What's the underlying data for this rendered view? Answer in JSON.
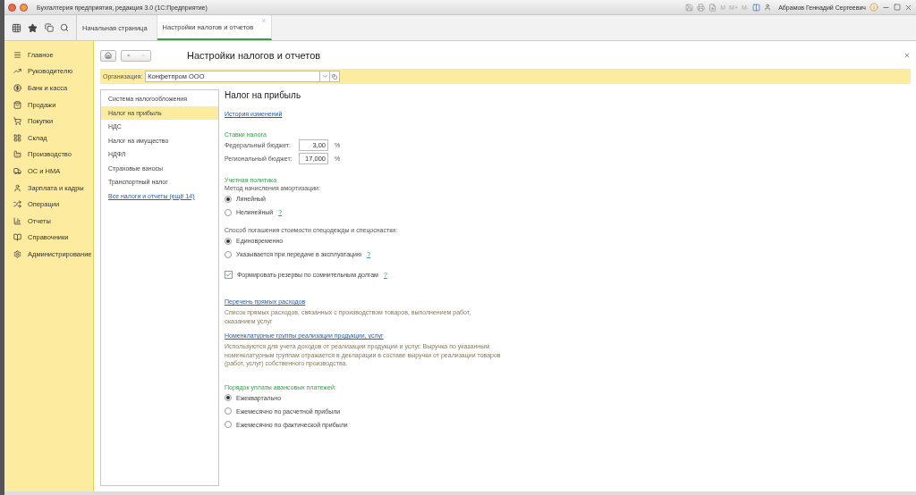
{
  "window": {
    "title": "Бухгалтерия предприятия, редакция 3.0  (1С:Предприятие)",
    "memory_buttons": [
      "M",
      "M+",
      "M-"
    ],
    "user": "Абрамов Геннадий Сергеевич"
  },
  "tabs": [
    {
      "label": "Начальная страница",
      "selected": false,
      "closable": false
    },
    {
      "label": "Настройки налогов и отчетов",
      "selected": true,
      "closable": true
    }
  ],
  "sidebar": {
    "items": [
      {
        "label": "Главное"
      },
      {
        "label": "Руководителю"
      },
      {
        "label": "Банк и касса"
      },
      {
        "label": "Продажи"
      },
      {
        "label": "Покупки"
      },
      {
        "label": "Склад"
      },
      {
        "label": "Производство"
      },
      {
        "label": "ОС и НМА"
      },
      {
        "label": "Зарплата и кадры"
      },
      {
        "label": "Операции"
      },
      {
        "label": "Отчеты"
      },
      {
        "label": "Справочники"
      },
      {
        "label": "Администрирование"
      }
    ]
  },
  "page": {
    "title": "Настройки налогов и отчетов",
    "organization": {
      "label": "Организация:",
      "value": "Конфетпром ООО"
    }
  },
  "sections": [
    {
      "label": "Система налогообложения",
      "selected": false,
      "kind": "item"
    },
    {
      "label": "Налог на прибыль",
      "selected": true,
      "kind": "item"
    },
    {
      "label": "НДС",
      "selected": false,
      "kind": "item"
    },
    {
      "label": "Налог на имущество",
      "selected": false,
      "kind": "item"
    },
    {
      "label": "НДФЛ",
      "selected": false,
      "kind": "item"
    },
    {
      "label": "Страховые взносы",
      "selected": false,
      "kind": "item"
    },
    {
      "label": "Транспортный налог",
      "selected": false,
      "kind": "item"
    },
    {
      "label": "Все налоги и отчеты (ещё 14)",
      "selected": false,
      "kind": "link"
    }
  ],
  "detail": {
    "title": "Налог на прибыль",
    "history_link": "История изменений",
    "blocks": [
      {
        "kind": "group",
        "text": "Ставки налога"
      },
      {
        "kind": "field",
        "label": "Федеральный бюджет:",
        "value": "3,00",
        "unit": "%"
      },
      {
        "kind": "field",
        "label": "Региональный бюджет:",
        "value": "17,000",
        "unit": "%"
      },
      {
        "kind": "gap"
      },
      {
        "kind": "group",
        "text": "Учетная политика"
      },
      {
        "kind": "label",
        "text": "Метод начисления амортизации:"
      },
      {
        "kind": "radio",
        "label": "Линейный",
        "selected": true
      },
      {
        "kind": "radio",
        "label": "Нелинейный",
        "selected": false,
        "help": "?"
      },
      {
        "kind": "gap"
      },
      {
        "kind": "label",
        "text": "Способ погашения стоимости спецодежды и спецоснастки:"
      },
      {
        "kind": "radio",
        "label": "Единовременно",
        "selected": true
      },
      {
        "kind": "radio",
        "label": "Указывается при передаче в эксплуатацию",
        "selected": false,
        "help": "?"
      },
      {
        "kind": "gap"
      },
      {
        "kind": "checkbox",
        "label": "Формировать резервы по сомнительным долгам",
        "checked": true,
        "help": "?"
      },
      {
        "kind": "gap"
      },
      {
        "kind": "gap"
      },
      {
        "kind": "link",
        "text": "Перечень прямых расходов"
      },
      {
        "kind": "note",
        "text": "Список прямых расходов, связанных с производством товаров, выполнением работ, оказанием услуг"
      },
      {
        "kind": "link",
        "text": "Номенклатурные группы реализации продукции, услуг"
      },
      {
        "kind": "note",
        "text": "Используются для учета доходов от реализации продукции и услуг. Выручка по указанным номенклатурным группам отражается в декларации в составе выручки от реализации товаров (работ, услуг) собственного производства."
      },
      {
        "kind": "gap"
      },
      {
        "kind": "group",
        "text": "Порядок уплаты авансовых платежей:"
      },
      {
        "kind": "radio",
        "label": "Ежеквартально",
        "selected": true
      },
      {
        "kind": "radio",
        "label": "Ежемесячно по расчетной прибыли",
        "selected": false
      },
      {
        "kind": "radio",
        "label": "Ежемесячно по фактической прибыли",
        "selected": false
      }
    ]
  }
}
